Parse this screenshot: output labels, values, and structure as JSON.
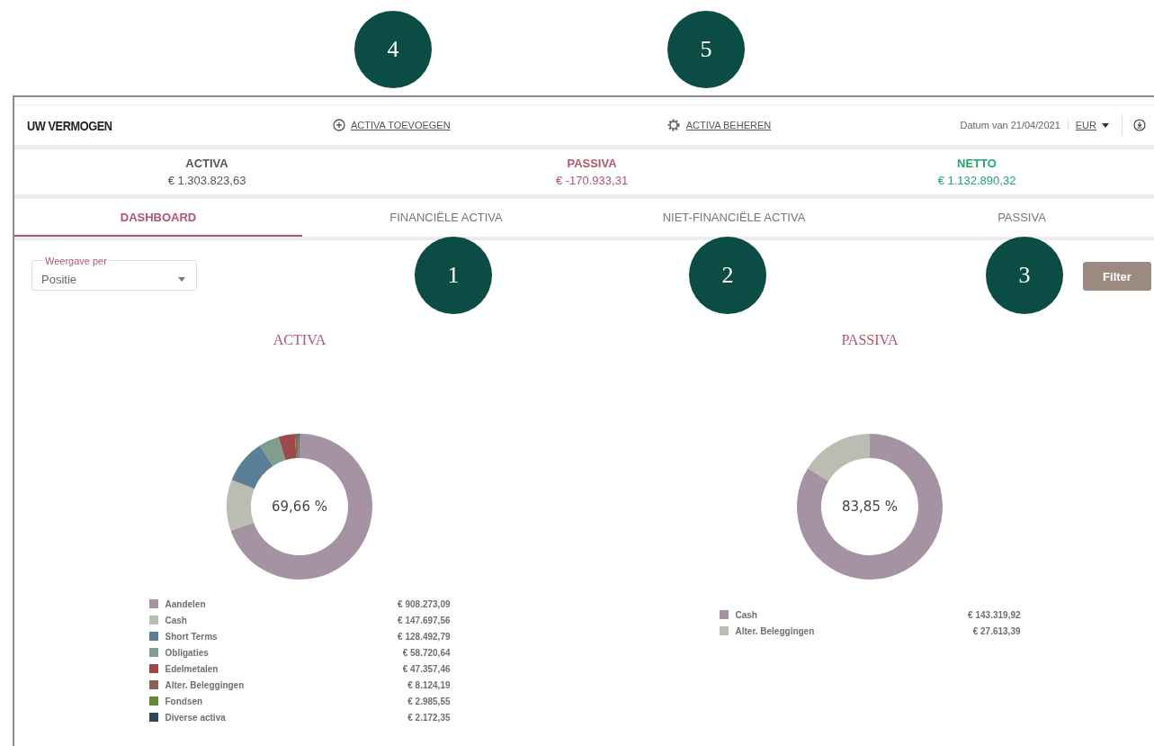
{
  "callouts": [
    "4",
    "5",
    "1",
    "2",
    "3"
  ],
  "header": {
    "title": "UW VERMOGEN",
    "add_link": "ACTIVA TOEVOEGEN",
    "manage_link": "ACTIVA BEHEREN",
    "date": "Datum van 21/04/2021",
    "currency": "EUR"
  },
  "summary": [
    {
      "label": "ACTIVA",
      "amount": "€ 1.303.823,63",
      "color": "#555555"
    },
    {
      "label": "PASSIVA",
      "amount": "€ -170.933,31",
      "color": "#b0586a"
    },
    {
      "label": "NETTO",
      "amount": "€ 1.132.890,32",
      "color": "#23a46e"
    }
  ],
  "tabs": [
    {
      "label": "DASHBOARD",
      "selected": true
    },
    {
      "label": "FINANCIËLE ACTIVA",
      "selected": false
    },
    {
      "label": "NIET-FINANCIËLE ACTIVA",
      "selected": false
    },
    {
      "label": "PASSIVA",
      "selected": false
    }
  ],
  "view_select": {
    "label": "Weergave per",
    "value": "Positie"
  },
  "filter_button": "Filter",
  "charts": [
    {
      "center_label": "69,66 %",
      "chart_data": {
        "type": "donut",
        "title": "ACTIVA",
        "categories": [
          "Aandelen",
          "Cash",
          "Short Terms",
          "Obligaties",
          "Edelmetalen",
          "Alter. Beleggingen",
          "Fondsen",
          "Diverse activa"
        ],
        "values": [
          69.66,
          11.33,
          9.86,
          4.5,
          3.63,
          0.62,
          0.23,
          0.17
        ]
      },
      "legend": [
        {
          "amount": "€ 908.273,09",
          "color": "#a593a3"
        },
        {
          "amount": "€ 147.697,56",
          "color": "#bcbdb2"
        },
        {
          "amount": "€ 128.492,79",
          "color": "#5b7f96"
        },
        {
          "amount": "€ 58.720,64",
          "color": "#7f9e8f"
        },
        {
          "amount": "€ 47.357,46",
          "color": "#9a4a4a"
        },
        {
          "amount": "€ 8.124,19",
          "color": "#8a6058"
        },
        {
          "amount": "€ 2.985,55",
          "color": "#5d8a3c"
        },
        {
          "amount": "€ 2.172,35",
          "color": "#2f4658"
        }
      ]
    },
    {
      "center_label": "83,85 %",
      "chart_data": {
        "type": "donut",
        "title": "PASSIVA",
        "categories": [
          "Cash",
          "Alter. Beleggingen"
        ],
        "values": [
          83.85,
          16.15
        ]
      },
      "legend": [
        {
          "amount": "€ 143.319,92",
          "color": "#a593a3"
        },
        {
          "amount": "€ 27.613,39",
          "color": "#bcbdb2"
        }
      ]
    }
  ]
}
